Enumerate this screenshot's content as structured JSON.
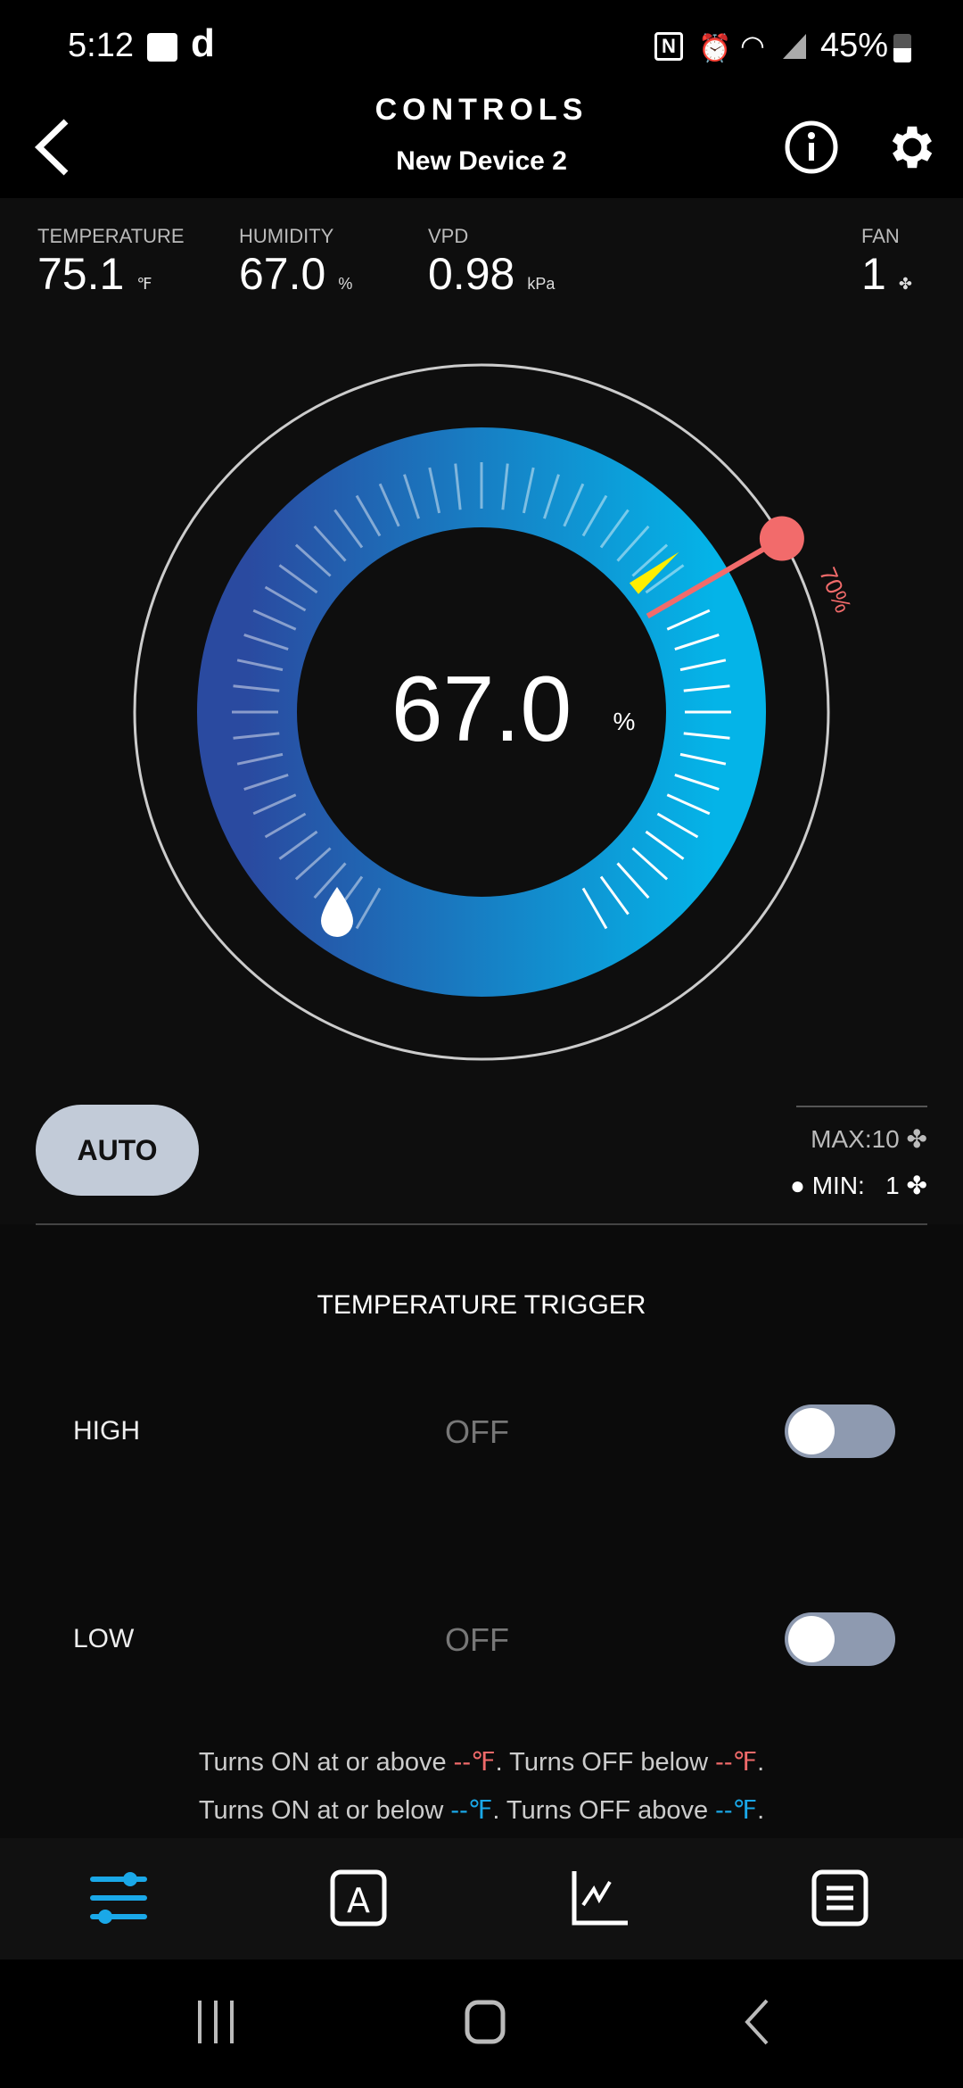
{
  "status_bar": {
    "time": "5:12",
    "battery": "45%",
    "icons": [
      "voicemail-icon",
      "app-d-icon",
      "nfc-icon",
      "alarm-icon",
      "wifi-icon",
      "signal-icon",
      "battery-icon"
    ]
  },
  "header": {
    "title": "CONTROLS",
    "subtitle": "New Device 2"
  },
  "stats": [
    {
      "label": "TEMPERATURE",
      "value": "75.1",
      "unit": "℉"
    },
    {
      "label": "HUMIDITY",
      "value": "67.0",
      "unit": "%"
    },
    {
      "label": "VPD",
      "value": "0.98",
      "unit": "kPa"
    },
    {
      "label": "FAN",
      "value": "1"
    }
  ],
  "gauge": {
    "value": "67.0",
    "unit": "%",
    "current": 67,
    "setpoint": 70,
    "setpoint_label": "70%",
    "range": [
      0,
      100
    ],
    "colors": {
      "ring_start": "#2a4aa0",
      "ring_end": "#04b4e8",
      "needle": "#ffee00",
      "setpoint": "#f26b6b"
    }
  },
  "mode": {
    "auto_label": "AUTO",
    "max_label": "MAX:10",
    "min_label": "MIN:",
    "min_value": "1"
  },
  "trigger": {
    "title": "TEMPERATURE TRIGGER",
    "high": {
      "label": "HIGH",
      "state": "OFF",
      "enabled": false
    },
    "low": {
      "label": "LOW",
      "state": "OFF",
      "enabled": false
    },
    "note_high": {
      "a": "Turns ON at or above ",
      "v1": "--℉",
      "b": ". Turns OFF below ",
      "v2": "--℉",
      "c": "."
    },
    "note_low": {
      "a": "Turns ON at or below ",
      "v1": "--℉",
      "b": ". Turns OFF above ",
      "v2": "--℉",
      "c": "."
    }
  },
  "tabs": [
    {
      "name": "controls",
      "active": true
    },
    {
      "name": "auto"
    },
    {
      "name": "chart"
    },
    {
      "name": "log"
    }
  ],
  "accent": "#1aa8e8"
}
